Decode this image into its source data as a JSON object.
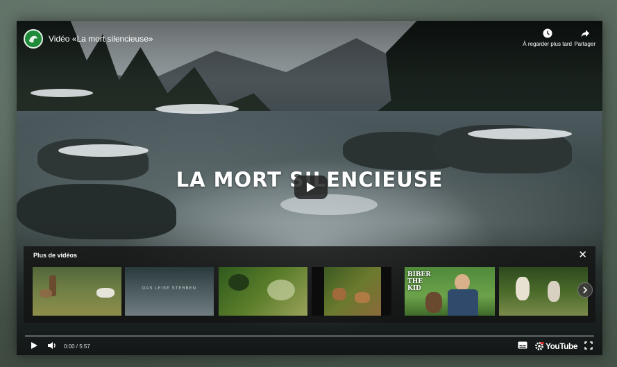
{
  "player": {
    "video_title": "Vidéo «La mort silencieuse»",
    "watch_later_label": "À regarder plus tard",
    "share_label": "Partager",
    "big_title": "LA MORT SILENCIEUSE",
    "icons": {
      "channel": "channel-logo-icon",
      "watch_later": "clock-icon",
      "share": "share-arrow-icon",
      "play": "play-icon"
    }
  },
  "more_videos": {
    "title": "Plus de vidéos",
    "close_label": "✕",
    "thumbnails": [
      {
        "overlay": ""
      },
      {
        "overlay": "DAS LEISE STERBEN"
      },
      {
        "overlay": ""
      },
      {
        "overlay": ""
      },
      {
        "overlay": "BIBER THE KID"
      },
      {
        "overlay": ""
      }
    ]
  },
  "controls": {
    "time": "0:00 / 5:57",
    "progress": 0,
    "youtube_label": "YouTube",
    "icons": [
      "play-icon",
      "volume-icon",
      "subtitles-icon",
      "settings-icon",
      "youtube-logo",
      "fullscreen-icon"
    ]
  },
  "colors": {
    "accent": "#ff0000",
    "channel_logo": "#1f8a3a"
  }
}
